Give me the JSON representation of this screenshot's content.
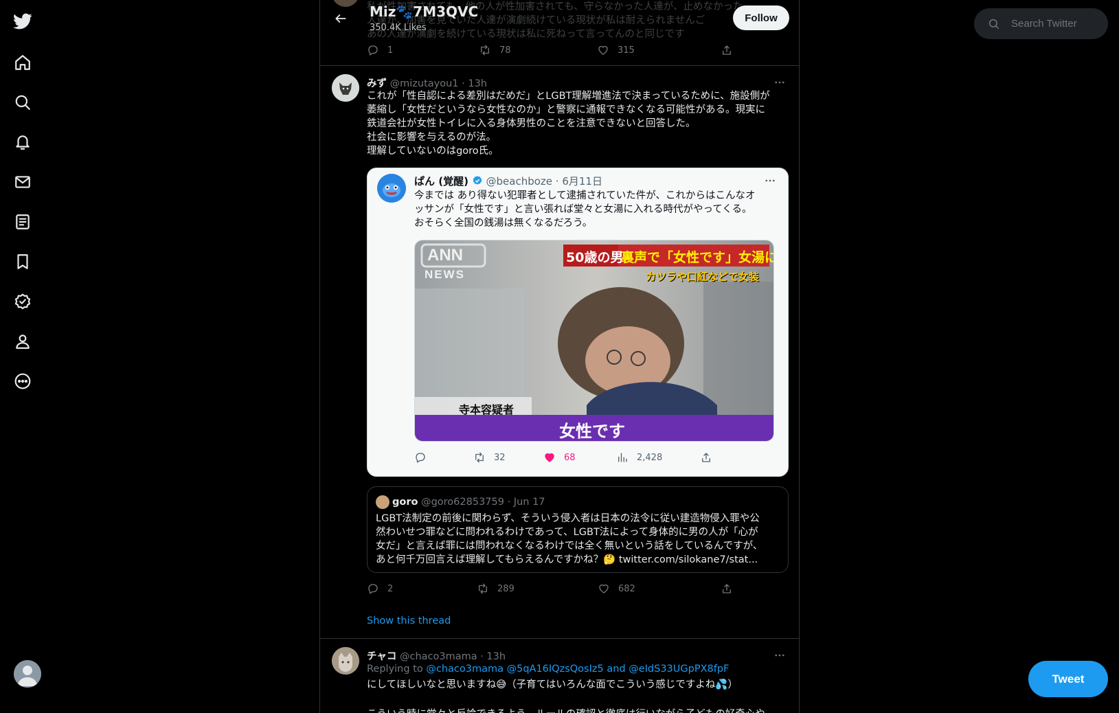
{
  "nav": {
    "items": [
      "twitter-logo",
      "home-icon",
      "explore-icon",
      "notifications-icon",
      "messages-icon",
      "lists-icon",
      "bookmarks-icon",
      "verified-icon",
      "profile-icon",
      "more-icon"
    ]
  },
  "header": {
    "title": "Miz🐾7M3QVC",
    "subtitle": "350.4K Likes",
    "follow_label": "Follow"
  },
  "prev_tweet": {
    "ghost_lines": [
      "私が性加害されても、他の人が性加害されても、守らなかった人達が、止めなかった",
      "人達が、加害を見ていた人達が演劇続けている現状が私は耐えられませんご",
      "あの人達が演劇を続けている現状は私に死ねって言ってんのと同じです"
    ],
    "replies": "1",
    "retweets": "78",
    "likes": "315"
  },
  "tweet": {
    "name": "みず",
    "handle": "@mizutayou1",
    "time": "· 13h",
    "text": [
      "これが「性自認による差別はだめだ」とLGBT理解増進法で決まっているために、施設側が",
      "萎縮し「女性だというなら女性なのか」と警察に通報できなくなる可能性がある。現実に",
      "鉄道会社が女性トイレに入る身体男性のことを注意できないと回答した。",
      "社会に影響を与えるのが法。",
      "理解していないのはgoro氏。"
    ],
    "replies": "2",
    "retweets": "289",
    "likes": "682",
    "show_thread": "Show this thread"
  },
  "quote1": {
    "name": "ぱん (覚醒)",
    "handle": "@beachboze",
    "date": "· 6月11日",
    "text": [
      "今までは あり得ない犯罪者として逮捕されていた件が、これからはこんなオ",
      "ッサンが「女性です」と言い張れば堂々と女湯に入れる時代がやってくる。",
      "おそらく全国の銭湯は無くなるだろう。"
    ],
    "image": {
      "logo": "ANN",
      "logo_sub": "NEWS",
      "headline_a": "50歳の男",
      "headline_b": "裏声で「女性です」女湯に…",
      "subhead": "カツラや口紅などで女装",
      "name_tag": "寺本容疑者",
      "caption": "女性です"
    },
    "retweets": "32",
    "likes": "68",
    "views": "2,428"
  },
  "quote2": {
    "name": "goro",
    "handle": "@goro62853759",
    "date": "· Jun 17",
    "text": [
      "LGBT法制定の前後に関わらず、そういう侵入者は日本の法令に従い建造物侵入罪や公",
      "然わいせつ罪などに問われるわけであって、LGBT法によって身体的に男の人が「心が",
      "女だ」と言えば罪には問われなくなるわけでは全く無いという話をしているんですが、",
      "あと何千万回言えば理解してもらえるんですかね？🤔 twitter.com/silokane7/stat..."
    ]
  },
  "tweet2": {
    "name": "チャコ",
    "handle": "@chaco3mama",
    "time": "· 13h",
    "replying_prefix": "Replying to",
    "replying_to": "@chaco3mama @5qA16IQzsQosIz5 and @eIdS33UGpPX8fpF",
    "text": "にしてほしいなと思いますね😅（子育てはいろんな面でこういう感じですよね💦）",
    "text_cut": "こういう時に堂々と反論できるよう、ルールの確認と徹底は行いながら子どもの好奇心や"
  },
  "search": {
    "placeholder": "Search Twitter"
  },
  "tweet_button": "Tweet"
}
